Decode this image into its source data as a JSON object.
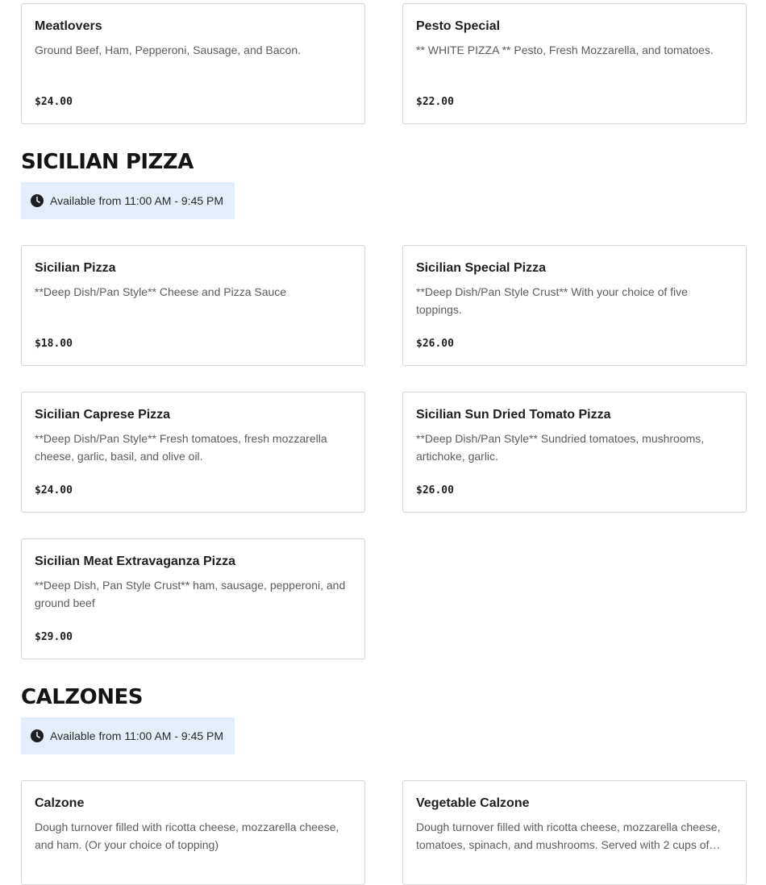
{
  "top_items": [
    {
      "name": "Meatlovers",
      "description": "Ground Beef, Ham, Pepperoni, Sausage, and Bacon.",
      "price": "$24.00"
    },
    {
      "name": "Pesto Special",
      "description": "** WHITE PIZZA ** Pesto, Fresh Mozzarella, and tomatoes.",
      "price": "$22.00"
    }
  ],
  "sections": [
    {
      "title": "SICILIAN PIZZA",
      "availability": "Available from 11:00 AM - 9:45 PM",
      "items": [
        {
          "name": "Sicilian Pizza",
          "description": "**Deep Dish/Pan Style** Cheese and Pizza Sauce",
          "price": "$18.00"
        },
        {
          "name": "Sicilian Special Pizza",
          "description": "**Deep Dish/Pan Style Crust** With your choice of five toppings.",
          "price": "$26.00"
        },
        {
          "name": "Sicilian Caprese Pizza",
          "description": "**Deep Dish/Pan Style** Fresh tomatoes, fresh mozzarella cheese, garlic, basil, and olive oil.",
          "price": "$24.00"
        },
        {
          "name": "Sicilian Sun Dried Tomato Pizza",
          "description": "**Deep Dish/Pan Style** Sundried tomatoes, mushrooms, artichoke, garlic.",
          "price": "$26.00"
        },
        {
          "name": "Sicilian Meat Extravaganza Pizza",
          "description": "**Deep Dish, Pan Style Crust** ham, sausage, pepperoni, and ground beef",
          "price": "$29.00"
        }
      ]
    },
    {
      "title": "CALZONES",
      "availability": "Available from 11:00 AM - 9:45 PM",
      "items": [
        {
          "name": "Calzone",
          "description": "Dough turnover filled with ricotta cheese, mozzarella cheese, and ham. (Or your choice of topping)",
          "price": ""
        },
        {
          "name": "Vegetable Calzone",
          "description": "Dough turnover filled with ricotta cheese, mozzarella cheese, tomatoes, spinach, and mushrooms. Served with 2 cups of…",
          "price": ""
        }
      ]
    }
  ],
  "icons": {
    "availability": "clock-icon"
  },
  "colors": {
    "availability_bg": "#e4eefb",
    "card_border": "#d6d6d6",
    "text": "#1f1f1f",
    "muted": "#5c5c5c"
  }
}
